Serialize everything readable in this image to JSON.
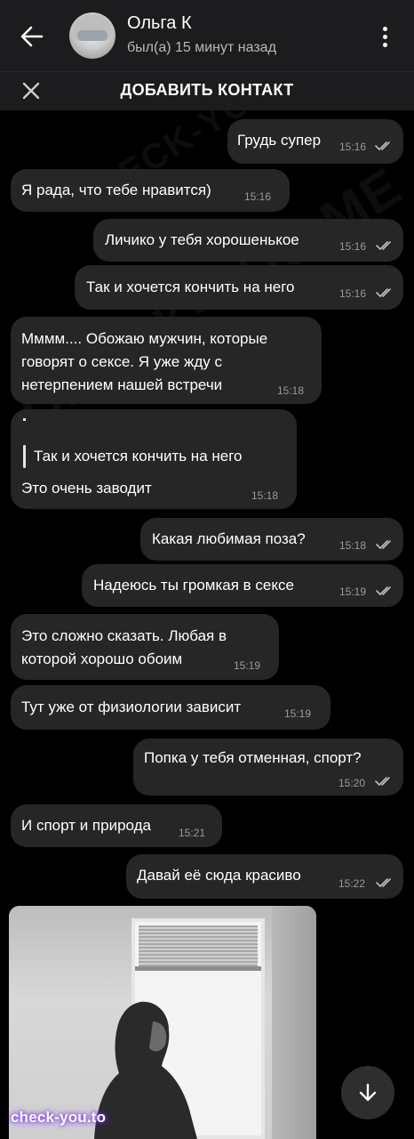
{
  "header": {
    "contact_name": "Ольга К",
    "status": "был(а) 15 минут назад"
  },
  "add_contact": {
    "label": "ДОБАВИТЬ КОНТАКТ"
  },
  "watermark": {
    "text": "CHECK-YOU.ME",
    "badge": "check-you.to"
  },
  "messages": [
    {
      "text": "Грудь супер",
      "time": "15:16",
      "side": "out"
    },
    {
      "text": "Я рада, что тебе нравится)",
      "time": "15:16",
      "side": "in"
    },
    {
      "text": "Личико у тебя хорошенькое",
      "time": "15:16",
      "side": "out"
    },
    {
      "text": "Так и хочется кончить на него",
      "time": "15:16",
      "side": "out"
    },
    {
      "lines": [
        "Мммм.... Обожаю мужчин, которые",
        "говорят о сексе. Я уже жду с",
        "нетерпением нашей встречи"
      ],
      "time": "15:18",
      "side": "in"
    },
    {
      "reply_to": "Так и хочется кончить на него",
      "text": "Это очень заводит",
      "time": "15:18",
      "side": "in"
    },
    {
      "text": "Какая любимая поза?",
      "time": "15:18",
      "side": "out"
    },
    {
      "text": "Надеюсь ты громкая в сексе",
      "time": "15:19",
      "side": "out"
    },
    {
      "lines": [
        "Это сложно сказать. Любая в",
        "которой хорошо обоим"
      ],
      "time": "15:19",
      "side": "in"
    },
    {
      "text": "Тут уже от физиологии зависит",
      "time": "15:19",
      "side": "in"
    },
    {
      "text": "Попка у тебя отменная, спорт?",
      "time": "15:20",
      "side": "out"
    },
    {
      "text": "И спорт и природа",
      "time": "15:21",
      "side": "in"
    },
    {
      "text": "Давай её сюда красиво",
      "time": "15:22",
      "side": "out"
    }
  ],
  "icons": {
    "back": "arrow-left-icon",
    "more": "more-vertical-icon",
    "close": "close-icon",
    "read": "double-check-icon",
    "scroll": "arrow-down-icon"
  },
  "colors": {
    "background": "#000000",
    "bubble": "#262626",
    "header": "#1c1c1e",
    "time": "#9a9a9a"
  }
}
